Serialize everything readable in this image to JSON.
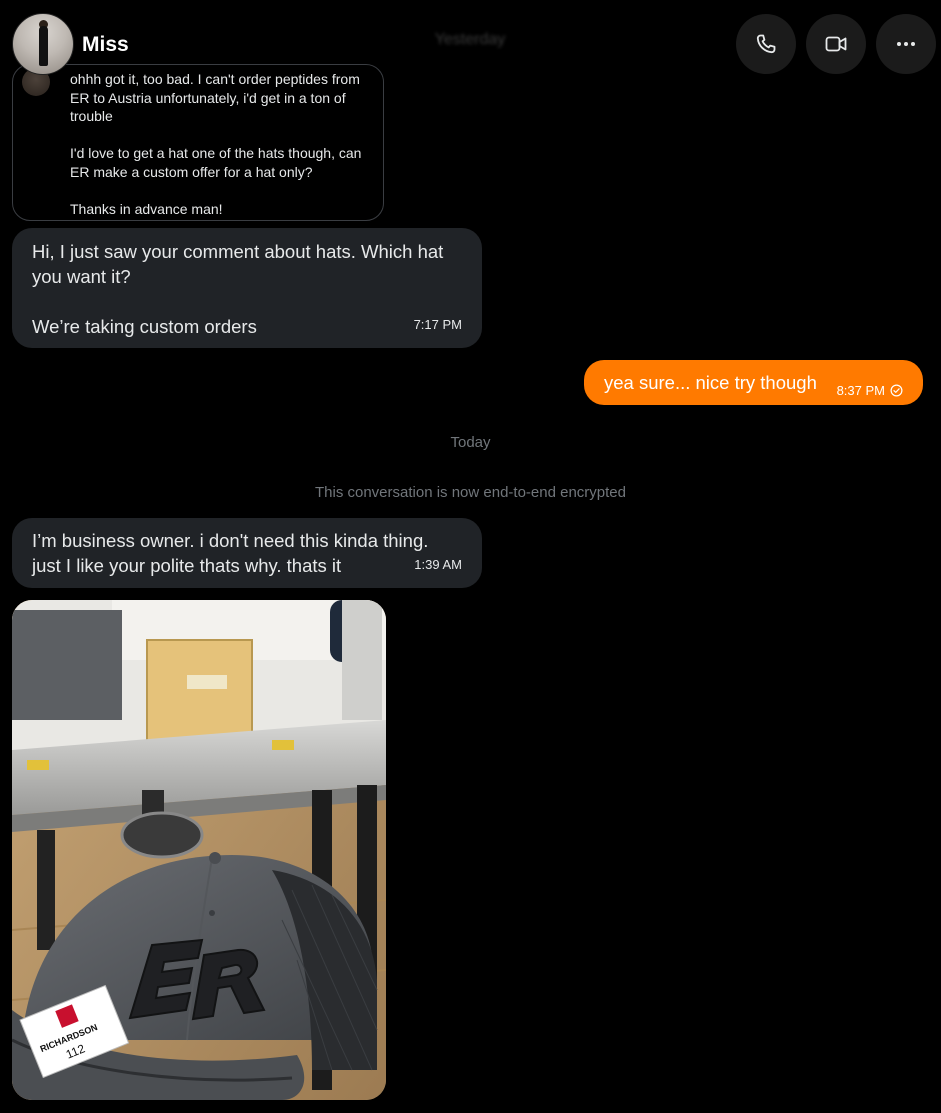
{
  "header": {
    "contact_name": "Miss",
    "faded_date": "Yesterday",
    "actions": [
      {
        "icon": "phone-icon",
        "label": "Call"
      },
      {
        "icon": "video-icon",
        "label": "Video call"
      },
      {
        "icon": "more-icon",
        "label": "More"
      }
    ]
  },
  "quoted_message": {
    "text": "ohhh got it, too bad. I can't order peptides from ER to Austria unfortunately, i'd get in a ton of trouble\n\nI'd love to get a hat one of the hats though, can ER make a custom offer for a hat only?\n\nThanks in advance man!"
  },
  "messages": [
    {
      "direction": "incoming",
      "text": "Hi, I just saw your comment about hats. Which hat you want it?\n\nWe’re taking custom orders",
      "time": "7:17 PM"
    },
    {
      "direction": "outgoing",
      "text": "yea sure... nice try though",
      "time": "8:37 PM",
      "status_icon": "check-circle-icon"
    },
    {
      "direction": "incoming",
      "text": "I’m business owner. i don't need this kinda thing.\njust I like your polite thats why. thats it",
      "time": "1:39 AM"
    }
  ],
  "separators": {
    "day": "Today",
    "encryption": "This conversation is now end-to-end encrypted"
  },
  "photo": {
    "hat_logo": "ER",
    "tag_brand": "RICHARDSON",
    "tag_model": "112"
  },
  "colors": {
    "background": "#000000",
    "incoming_bubble": "#202327",
    "outgoing_bubble": "#ff7a00",
    "muted_text": "#71767b",
    "header_button": "#1b1b1b"
  }
}
